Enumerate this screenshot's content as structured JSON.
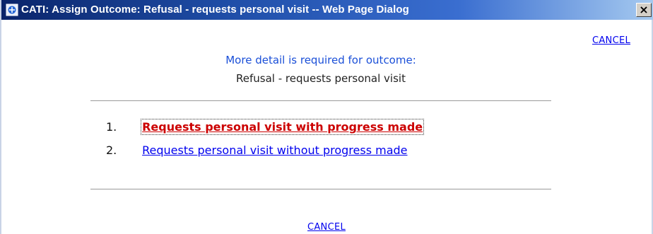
{
  "window": {
    "title": "CATI: Assign Outcome: Refusal - requests personal visit -- Web Page Dialog",
    "close_glyph": "×",
    "icon": "ie-page-icon"
  },
  "dialog": {
    "cancel_top": "CANCEL",
    "intro": "More detail is required for outcome:",
    "outcome": "Refusal - requests personal visit",
    "options": [
      {
        "number": "1.",
        "label": "Requests personal visit with progress made",
        "focused": true
      },
      {
        "number": "2.",
        "label": "Requests personal visit without progress made",
        "focused": false
      }
    ],
    "cancel_bottom": "CANCEL"
  },
  "colors": {
    "link": "#0000ee",
    "focused_link": "#cc0000",
    "intro_text": "#1a4fd8",
    "titlebar_start": "#0a246a",
    "titlebar_end": "#a6caf0"
  }
}
